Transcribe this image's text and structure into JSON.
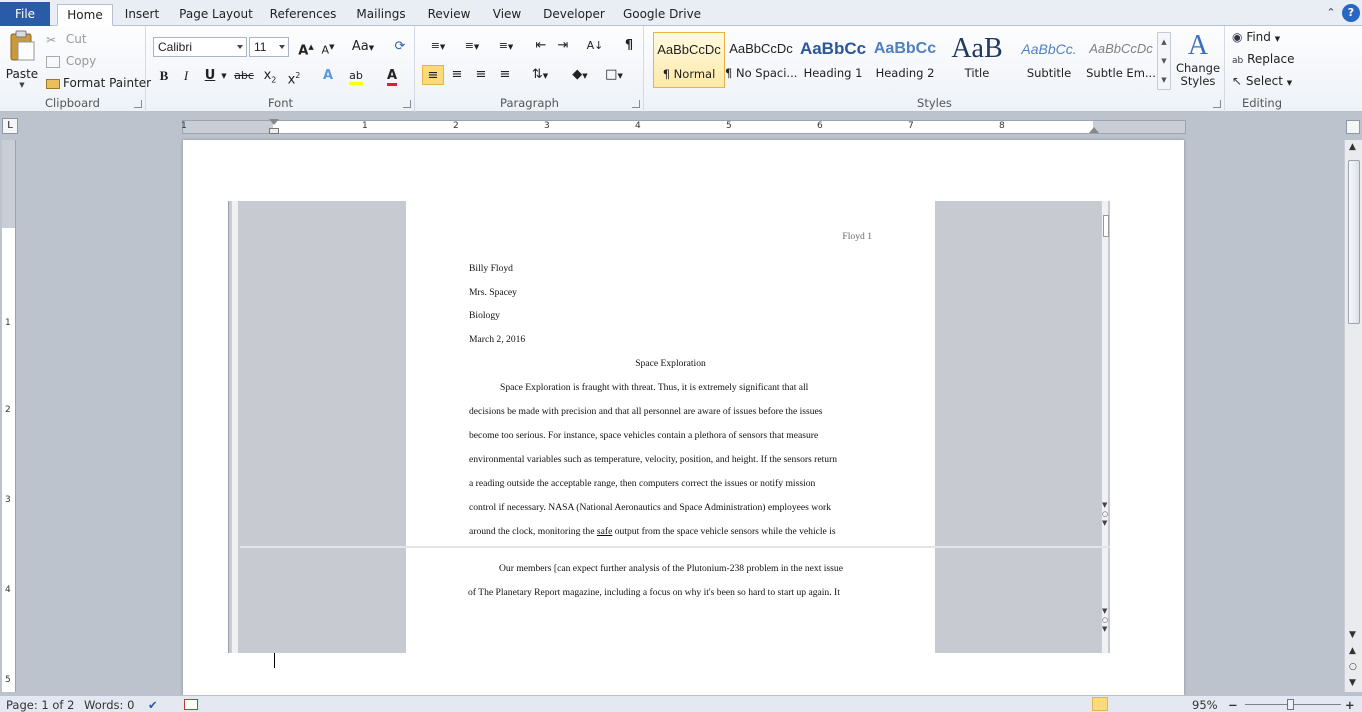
{
  "tabs": [
    "File",
    "Home",
    "Insert",
    "Page Layout",
    "References",
    "Mailings",
    "Review",
    "View",
    "Developer",
    "Google Drive"
  ],
  "clipboard": {
    "group_label": "Clipboard",
    "paste": "Paste",
    "cut": "Cut",
    "copy": "Copy",
    "format_painter": "Format Painter"
  },
  "font": {
    "group_label": "Font",
    "name": "Calibri",
    "size": "11"
  },
  "paragraph": {
    "group_label": "Paragraph"
  },
  "styles": {
    "group_label": "Styles",
    "items": [
      {
        "preview": "AaBbCcDc",
        "name": "¶ Normal"
      },
      {
        "preview": "AaBbCcDc",
        "name": "¶ No Spaci..."
      },
      {
        "preview": "AaBbCc",
        "name": "Heading 1"
      },
      {
        "preview": "AaBbCc",
        "name": "Heading 2"
      },
      {
        "preview": "AaB",
        "name": "Title"
      },
      {
        "preview": "AaBbCc.",
        "name": "Subtitle"
      },
      {
        "preview": "AaBbCcDc",
        "name": "Subtle Em..."
      }
    ],
    "change_styles": "Change Styles"
  },
  "editing": {
    "group_label": "Editing",
    "find": "Find",
    "replace": "Replace",
    "select": "Select"
  },
  "ruler": {
    "h_numbers": [
      "1",
      "1",
      "2",
      "3",
      "4",
      "5",
      "6",
      "7",
      "8"
    ],
    "v_numbers": [
      "1",
      "2",
      "3",
      "4",
      "5"
    ]
  },
  "document": {
    "header": "Floyd 1",
    "lines": [
      "Billy Floyd",
      "Mrs. Spacey",
      "Biology",
      "March 2, 2016"
    ],
    "title": "Space Exploration",
    "para1": [
      "Space Exploration is fraught with threat. Thus, it is extremely significant that all",
      "decisions be made with precision and that all personnel are aware of issues before the issues",
      "become too serious.  For instance, space vehicles contain a plethora of sensors that measure",
      "environmental variables  such as temperature, velocity, position, and height. If the sensors return",
      "a reading outside the acceptable range, then computers correct the issues or notify mission",
      "control if necessary. NASA (National Aeronautics and Space Administration) employees  work"
    ],
    "para1_last_before": "around the clock, monitoring the ",
    "para1_last_underlined": "safe",
    "para1_last_after": " output from the space vehicle  sensors while the vehicle is",
    "para2": [
      "Our members  [can expect further analysis  of the Plutonium-238 problem in the next issue",
      "of The Planetary Report magazine, including a focus on why it's been so hard to start up again.  It"
    ]
  },
  "status": {
    "page": "Page: 1 of 2",
    "words": "Words: 0",
    "zoom": "95%"
  }
}
